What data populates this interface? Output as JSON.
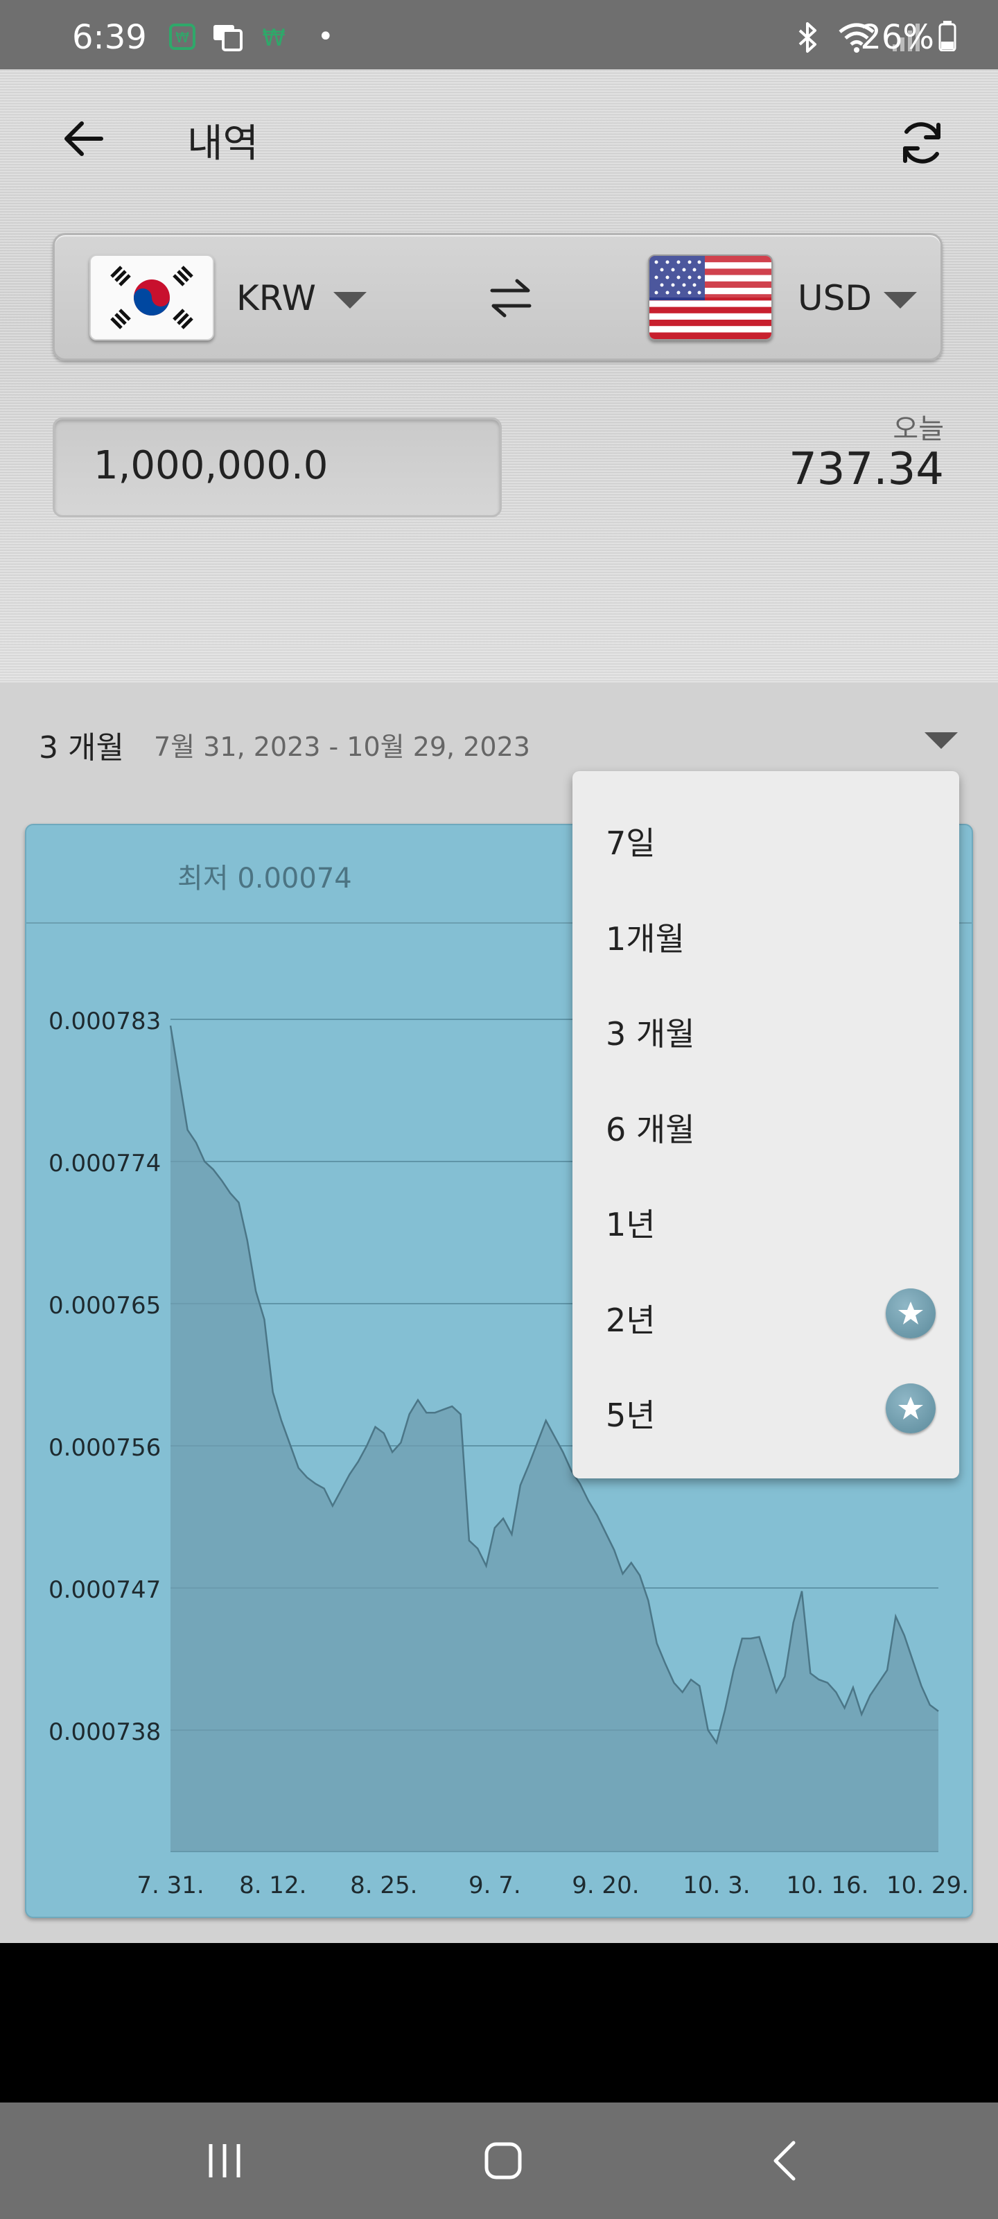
{
  "status_bar": {
    "time": "6:39",
    "battery_percent": "26%",
    "dot": "•"
  },
  "header": {
    "title": "내역"
  },
  "converter": {
    "from_currency": "KRW",
    "to_currency": "USD",
    "amount": "1,000,000.0",
    "today_label": "오늘",
    "today_value": "737.34"
  },
  "period": {
    "selected": "3 개월",
    "range": "7월 31, 2023 - 10월 29, 2023"
  },
  "chart_header": {
    "min_label": "최저 0.00074"
  },
  "dropdown": {
    "items": [
      {
        "label": "7일",
        "starred": false
      },
      {
        "label": "1개월",
        "starred": false
      },
      {
        "label": "3 개월",
        "starred": false
      },
      {
        "label": "6 개월",
        "starred": false
      },
      {
        "label": "1년",
        "starred": false
      },
      {
        "label": "2년",
        "starred": true
      },
      {
        "label": "5년",
        "starred": true
      }
    ]
  },
  "colors": {
    "chart_bg": "#84bfd3",
    "line": "#4b7687",
    "fill": "#6f9eb0",
    "star": "#5b8a9b"
  },
  "chart_data": {
    "type": "area",
    "ytick_labels": [
      "0.000783",
      "0.000774",
      "0.000765",
      "0.000756",
      "0.000747",
      "0.000738"
    ],
    "yticks": [
      0.000783,
      0.000774,
      0.000765,
      0.000756,
      0.000747,
      0.000738
    ],
    "xtick_labels": [
      "7. 31.",
      "8. 12.",
      "8. 25.",
      "9. 7.",
      "9. 20.",
      "10. 3.",
      "10. 16.",
      "10. 29."
    ],
    "xtick_index": [
      0,
      12,
      25,
      38,
      51,
      64,
      77,
      90
    ],
    "ylim": [
      0.0007304,
      0.0007838
    ],
    "x_count": 91,
    "values": [
      0.0007826,
      0.0007793,
      0.000776,
      0.0007752,
      0.000774,
      0.0007735,
      0.0007728,
      0.000772,
      0.0007714,
      0.000769,
      0.0007658,
      0.000764,
      0.0007594,
      0.0007576,
      0.0007561,
      0.0007546,
      0.000754,
      0.0007536,
      0.0007533,
      0.0007522,
      0.0007532,
      0.0007542,
      0.000755,
      0.000756,
      0.0007572,
      0.0007568,
      0.0007556,
      0.0007562,
      0.000758,
      0.0007589,
      0.0007581,
      0.0007581,
      0.0007583,
      0.0007585,
      0.000758,
      0.00075,
      0.0007495,
      0.0007484,
      0.0007508,
      0.0007514,
      0.0007504,
      0.0007535,
      0.0007548,
      0.0007562,
      0.0007576,
      0.0007566,
      0.0007556,
      0.0007544,
      0.0007536,
      0.0007525,
      0.0007516,
      0.0007505,
      0.0007494,
      0.0007479,
      0.0007486,
      0.0007478,
      0.0007462,
      0.0007435,
      0.0007422,
      0.000741,
      0.0007404,
      0.0007412,
      0.0007408,
      0.000738,
      0.0007372,
      0.0007393,
      0.0007418,
      0.0007438,
      0.0007438,
      0.0007439,
      0.0007422,
      0.0007404,
      0.0007414,
      0.0007448,
      0.0007468,
      0.0007416,
      0.0007412,
      0.000741,
      0.0007404,
      0.0007394,
      0.0007407,
      0.000739,
      0.0007402,
      0.000741,
      0.0007418,
      0.0007452,
      0.000744,
      0.0007424,
      0.0007408,
      0.0007396,
      0.0007392
    ]
  }
}
